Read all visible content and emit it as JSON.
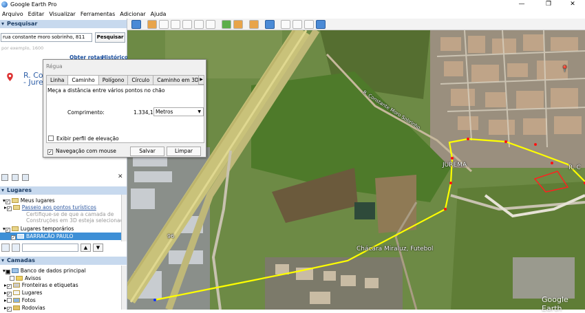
{
  "window": {
    "title": "Google Earth Pro",
    "min": "—",
    "max": "❐",
    "close": "✕"
  },
  "menu": [
    "Arquivo",
    "Editar",
    "Visualizar",
    "Ferramentas",
    "Adicionar",
    "Ajuda"
  ],
  "search": {
    "header": "Pesquisar",
    "query": "rua constante moro sobrinho, 811",
    "button": "Pesquisar",
    "hint": "por exemplo, 1600",
    "get_directions": "Obter rotas",
    "history": "Histórico",
    "result_line1": "R. Co",
    "result_line2": "- Jurer"
  },
  "places": {
    "header": "Lugares",
    "my_places": "Meus lugares",
    "tour": "Passeio aos pontos turísticos",
    "tour_note1": "Certifique-se de que a camada de",
    "tour_note2": "Construções em 3D esteja selecionada",
    "temp": "Lugares temporários",
    "selected": "BARRACÃO PAULO"
  },
  "layers": {
    "header": "Camadas",
    "db": "Banco de dados principal",
    "items": [
      "Avisos",
      "Fronteiras e etiquetas",
      "Lugares",
      "Fotos",
      "Rodovias"
    ]
  },
  "ruler": {
    "title": "Régua",
    "tabs": [
      "Linha",
      "Caminho",
      "Polígono",
      "Círculo",
      "Caminho em 3D"
    ],
    "active_tab": "Caminho",
    "description": "Meça a distância entre vários pontos no chão",
    "length_label": "Comprimento:",
    "length_value": "1.334,19",
    "unit": "Metros",
    "elevation": "Exibir perfil de elevação",
    "mouse_nav": "Navegação com mouse",
    "save": "Salvar",
    "clear": "Limpar"
  },
  "map": {
    "labels": {
      "street": "R. Constante Moro Sobrinho",
      "jurema": "JUREMA",
      "chacara": "Chácara Miraluz, Futebol",
      "r_partial": "R. C",
      "road_num": "96"
    },
    "watermark": "Google Earth",
    "path_color": "#ffff00",
    "polygon_color": "#ff2020"
  }
}
